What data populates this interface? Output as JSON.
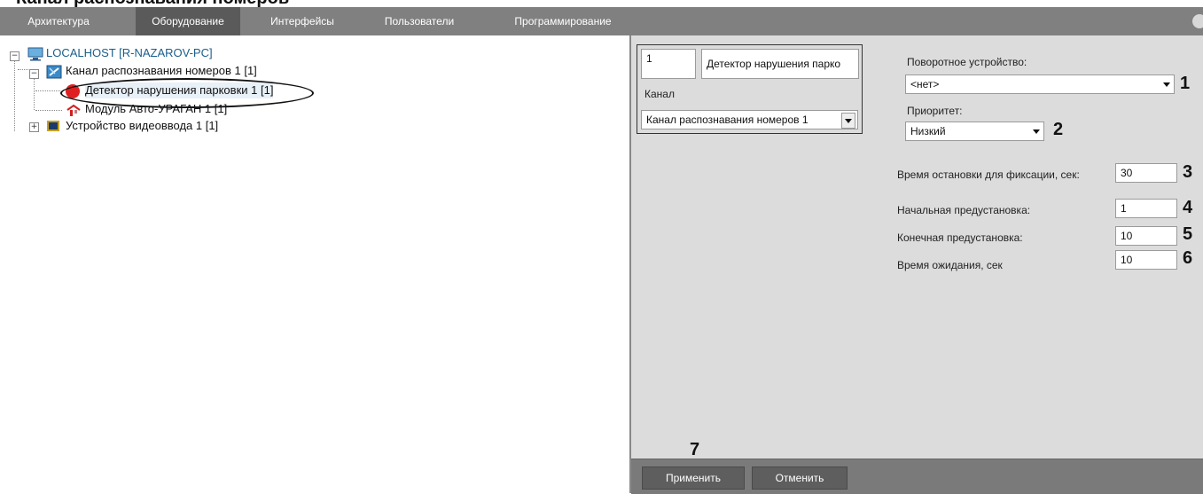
{
  "doc_heading_cut": "Канал распознавания номеров",
  "tabs": [
    {
      "label": "Архитектура"
    },
    {
      "label": "Оборудование"
    },
    {
      "label": "Интерфейсы"
    },
    {
      "label": "Пользователи"
    },
    {
      "label": "Программирование"
    }
  ],
  "active_tab": "Оборудование",
  "tree": {
    "root": "LOCALHOST [R-NAZAROV-PC]",
    "channel": "Канал распознавания номеров 1 [1]",
    "detector": "Детектор нарушения парковки 1 [1]",
    "module": "Модуль Авто-УРАГАН 1 [1]",
    "video_device": "Устройство видеоввода 1 [1]"
  },
  "form": {
    "id_value": "1",
    "name_value": "Детектор нарушения парко",
    "channel_label": "Канал",
    "channel_value": "Канал распознавания номеров 1",
    "ptz_label": "Поворотное устройство:",
    "ptz_value": "<нет>",
    "priority_label": "Приоритет:",
    "priority_value": "Низкий",
    "stop_time_label": "Время остановки для фиксации, сек:",
    "stop_time_value": "30",
    "start_preset_label": "Начальная предустановка:",
    "start_preset_value": "1",
    "end_preset_label": "Конечная предустановка:",
    "end_preset_value": "10",
    "wait_time_label": "Время ожидания, сек",
    "wait_time_value": "10"
  },
  "callouts": [
    "1",
    "2",
    "3",
    "4",
    "5",
    "6",
    "7"
  ],
  "buttons": {
    "apply": "Применить",
    "cancel": "Отменить"
  },
  "colors": {
    "menubar": "#808080",
    "active_tab": "#5a5a5a",
    "panel": "#dcdcdc",
    "bottombar": "#7a7a7a",
    "tree_root": "#1a5e8a",
    "detector_dot": "#e02020"
  },
  "icons": {
    "root": "computer-icon",
    "channel": "channel-icon",
    "detector": "red-dot-icon",
    "module": "module-icon",
    "video_device": "chip-icon"
  }
}
